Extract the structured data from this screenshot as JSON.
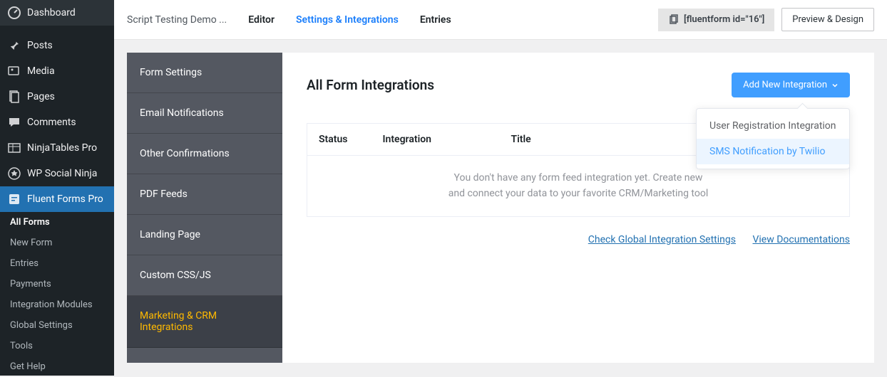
{
  "wp_sidebar": {
    "items": [
      {
        "label": "Dashboard"
      },
      {
        "label": "Posts"
      },
      {
        "label": "Media"
      },
      {
        "label": "Pages"
      },
      {
        "label": "Comments"
      },
      {
        "label": "NinjaTables Pro"
      },
      {
        "label": "WP Social Ninja"
      },
      {
        "label": "Fluent Forms Pro"
      }
    ],
    "submenu": [
      {
        "label": "All Forms"
      },
      {
        "label": "New Form"
      },
      {
        "label": "Entries"
      },
      {
        "label": "Payments"
      },
      {
        "label": "Integration Modules"
      },
      {
        "label": "Global Settings"
      },
      {
        "label": "Tools"
      },
      {
        "label": "Get Help"
      }
    ]
  },
  "top_bar": {
    "page_title": "Script Testing Demo ...",
    "tabs": [
      {
        "label": "Editor"
      },
      {
        "label": "Settings & Integrations"
      },
      {
        "label": "Entries"
      }
    ],
    "shortcode": "[fluentform id=\"16\"]",
    "preview_btn": "Preview & Design"
  },
  "settings_nav": [
    {
      "label": "Form Settings"
    },
    {
      "label": "Email Notifications"
    },
    {
      "label": "Other Confirmations"
    },
    {
      "label": "PDF Feeds"
    },
    {
      "label": "Landing Page"
    },
    {
      "label": "Custom CSS/JS"
    },
    {
      "label": "Marketing & CRM Integrations"
    }
  ],
  "panel": {
    "title": "All Form Integrations",
    "add_btn": "Add New Integration",
    "dropdown": [
      {
        "label": "User Registration Integration"
      },
      {
        "label": "SMS Notification by Twilio"
      }
    ],
    "table_headers": {
      "status": "Status",
      "integration": "Integration",
      "title": "Title"
    },
    "empty_msg_line1": "You don't have any form feed integration yet. Create new",
    "empty_msg_line2": "and connect your data to your favorite CRM/Marketing tool",
    "links": {
      "global": "Check Global Integration Settings",
      "docs": "View Documentations"
    }
  }
}
